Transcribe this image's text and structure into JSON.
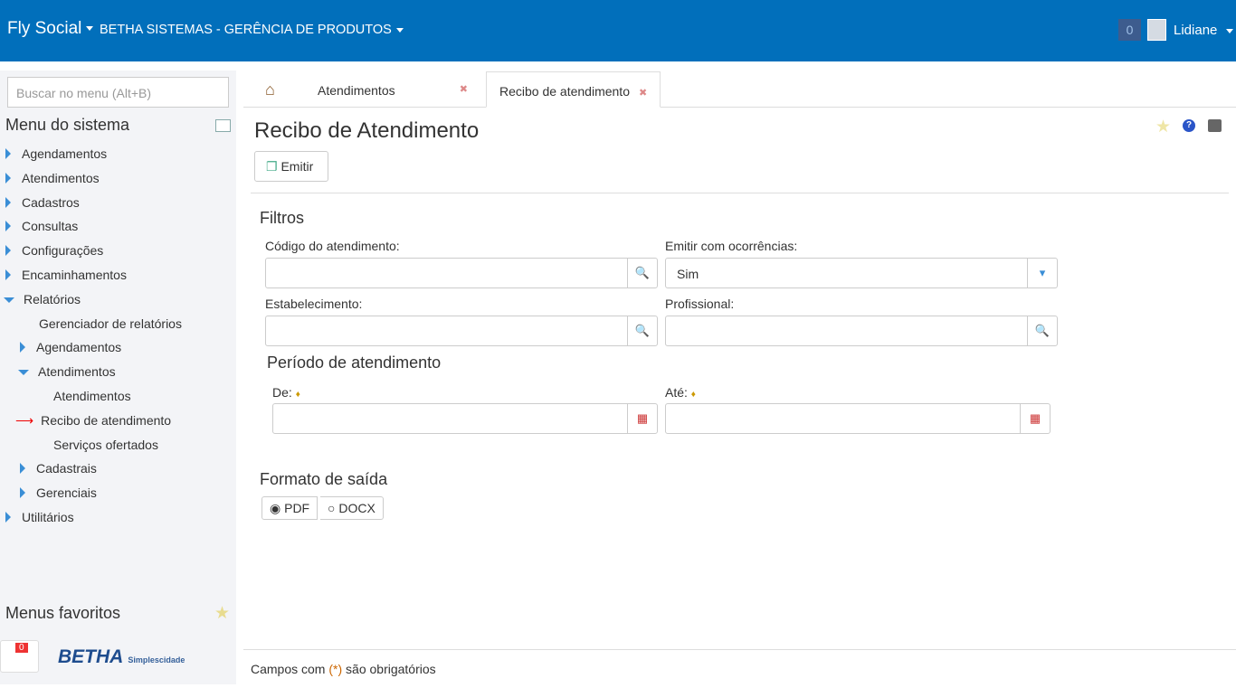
{
  "header": {
    "app": "Fly Social",
    "org": "BETHA SISTEMAS - GERÊNCIA DE PRODUTOS",
    "notifications": "0",
    "user": "Lidiane"
  },
  "sidebar": {
    "search_placeholder": "Buscar no menu (Alt+B)",
    "title": "Menu do sistema",
    "favorites": "Menus favoritos",
    "support_badge": "0",
    "logo": "BETHA Simplescidade",
    "items": [
      "Agendamentos",
      "Atendimentos",
      "Cadastros",
      "Consultas",
      "Configurações",
      "Encaminhamentos",
      "Relatórios",
      "Gerenciador de relatórios",
      "Agendamentos",
      "Atendimentos",
      "Atendimentos",
      "Recibo de atendimento",
      "Serviços ofertados",
      "Cadastrais",
      "Gerenciais",
      "Utilitários"
    ]
  },
  "tabs": [
    "Atendimentos",
    "Recibo de atendimento"
  ],
  "page": {
    "title": "Recibo de Atendimento",
    "emit": "Emitir",
    "filters": "Filtros",
    "codigo": "Código do atendimento:",
    "emitir_ocorr": "Emitir com ocorrências:",
    "emitir_value": "Sim",
    "estab": "Estabelecimento:",
    "prof": "Profissional:",
    "periodo": "Período de atendimento",
    "de": "De:",
    "ate": "Até:",
    "formato": "Formato de saída",
    "pdf": "PDF",
    "docx": "DOCX",
    "selected_format": "PDF",
    "footer_a": "Campos com ",
    "footer_req": "(*)",
    "footer_b": " são obrigatórios"
  }
}
